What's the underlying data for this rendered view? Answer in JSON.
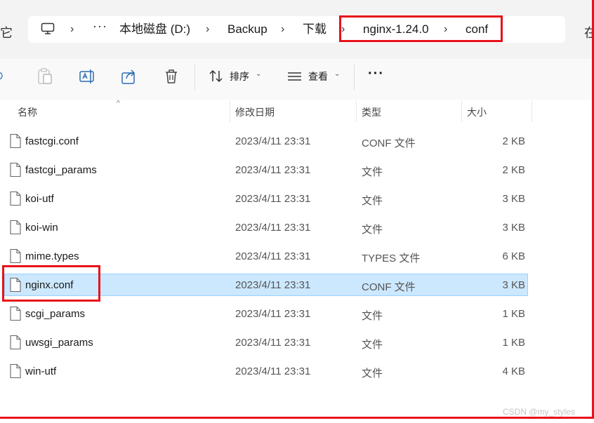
{
  "edge_left_char": "它",
  "edge_right_char": "在",
  "breadcrumb": {
    "items": [
      "本地磁盘 (D:)",
      "Backup",
      "下载",
      "nginx-1.24.0",
      "conf"
    ],
    "separator": "›",
    "overflow": "···"
  },
  "toolbar": {
    "sort_label": "排序",
    "view_label": "查看",
    "more": "···"
  },
  "columns": {
    "name": "名称",
    "modified": "修改日期",
    "type": "类型",
    "size": "大小"
  },
  "files": [
    {
      "name": "fastcgi.conf",
      "modified": "2023/4/11 23:31",
      "type": "CONF 文件",
      "size": "2 KB",
      "selected": false
    },
    {
      "name": "fastcgi_params",
      "modified": "2023/4/11 23:31",
      "type": "文件",
      "size": "2 KB",
      "selected": false
    },
    {
      "name": "koi-utf",
      "modified": "2023/4/11 23:31",
      "type": "文件",
      "size": "3 KB",
      "selected": false
    },
    {
      "name": "koi-win",
      "modified": "2023/4/11 23:31",
      "type": "文件",
      "size": "3 KB",
      "selected": false
    },
    {
      "name": "mime.types",
      "modified": "2023/4/11 23:31",
      "type": "TYPES 文件",
      "size": "6 KB",
      "selected": false
    },
    {
      "name": "nginx.conf",
      "modified": "2023/4/11 23:31",
      "type": "CONF 文件",
      "size": "3 KB",
      "selected": true
    },
    {
      "name": "scgi_params",
      "modified": "2023/4/11 23:31",
      "type": "文件",
      "size": "1 KB",
      "selected": false
    },
    {
      "name": "uwsgi_params",
      "modified": "2023/4/11 23:31",
      "type": "文件",
      "size": "1 KB",
      "selected": false
    },
    {
      "name": "win-utf",
      "modified": "2023/4/11 23:31",
      "type": "文件",
      "size": "4 KB",
      "selected": false
    }
  ],
  "watermark": "CSDN @my_styles",
  "colors": {
    "highlight_box": "#e8121a",
    "selection_fill": "#cce8ff",
    "selection_border": "#99d1ff"
  }
}
